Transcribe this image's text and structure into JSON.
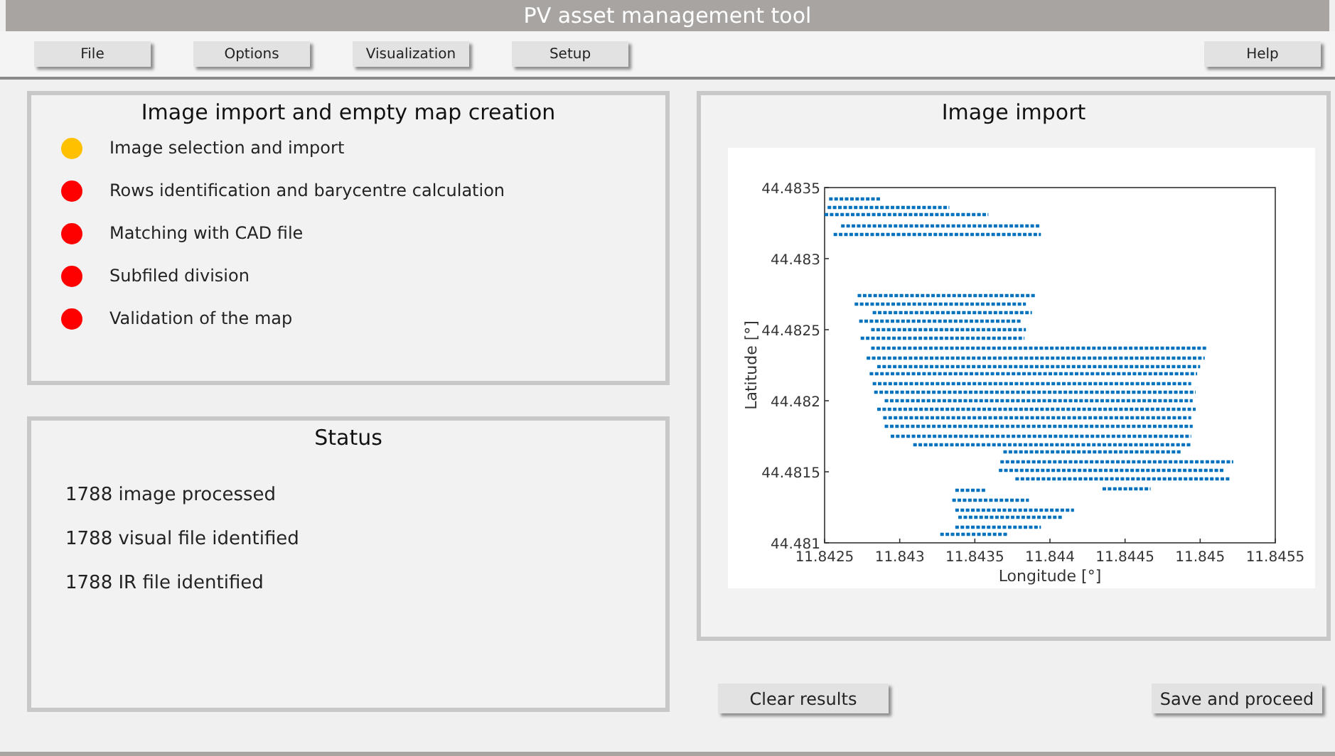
{
  "window": {
    "title": "PV asset management tool"
  },
  "menu": {
    "left": [
      "File",
      "Options",
      "Visualization",
      "Setup"
    ],
    "right": [
      "Help"
    ]
  },
  "steps_panel": {
    "title": "Image import and empty map creation",
    "steps": [
      {
        "label": "Image selection and import",
        "color": "#ffc000"
      },
      {
        "label": "Rows identification and barycentre calculation",
        "color": "#ff0000"
      },
      {
        "label": "Matching with CAD file",
        "color": "#ff0000"
      },
      {
        "label": "Subfiled division",
        "color": "#ff0000"
      },
      {
        "label": "Validation of the map",
        "color": "#ff0000"
      }
    ]
  },
  "status_panel": {
    "title": "Status",
    "lines": [
      "1788 image processed",
      "1788 visual file identified",
      "1788 IR file identified"
    ]
  },
  "image_panel": {
    "title": "Image import",
    "chart_data": {
      "type": "line",
      "xlabel": "Longitude [°]",
      "ylabel": "Latitude [°]",
      "xlim": [
        11.8425,
        11.8455
      ],
      "ylim": [
        44.481,
        44.4835
      ],
      "xticks": [
        11.8425,
        11.843,
        11.8435,
        11.844,
        11.8445,
        11.845,
        11.8455
      ],
      "yticks": [
        44.481,
        44.4815,
        44.482,
        44.4825,
        44.483,
        44.4835
      ],
      "series": [
        {
          "color": "#0072bd",
          "line_style": "dotted",
          "x": [
            11.84253,
            11.84287
          ],
          "values": [
            44.48342,
            44.48342
          ]
        },
        {
          "color": "#0072bd",
          "line_style": "dotted",
          "x": [
            11.84252,
            11.84333
          ],
          "values": [
            44.48336,
            44.48336
          ]
        },
        {
          "color": "#0072bd",
          "line_style": "dotted",
          "x": [
            11.8425,
            11.84359
          ],
          "values": [
            44.48331,
            44.48331
          ]
        },
        {
          "color": "#0072bd",
          "line_style": "dotted",
          "x": [
            11.84261,
            11.84393
          ],
          "values": [
            44.48323,
            44.48323
          ]
        },
        {
          "color": "#0072bd",
          "line_style": "dotted",
          "x": [
            11.84256,
            11.84394
          ],
          "values": [
            44.48317,
            44.48317
          ]
        },
        {
          "color": "#0072bd",
          "line_style": "dotted",
          "x": [
            11.84272,
            11.8439
          ],
          "values": [
            44.48274,
            44.48274
          ]
        },
        {
          "color": "#0072bd",
          "line_style": "dotted",
          "x": [
            11.8427,
            11.84384
          ],
          "values": [
            44.48268,
            44.48268
          ]
        },
        {
          "color": "#0072bd",
          "line_style": "dotted",
          "x": [
            11.84282,
            11.84388
          ],
          "values": [
            44.48262,
            44.48262
          ]
        },
        {
          "color": "#0072bd",
          "line_style": "dotted",
          "x": [
            11.84273,
            11.84381
          ],
          "values": [
            44.48256,
            44.48256
          ]
        },
        {
          "color": "#0072bd",
          "line_style": "dotted",
          "x": [
            11.84281,
            11.84384
          ],
          "values": [
            44.4825,
            44.4825
          ]
        },
        {
          "color": "#0072bd",
          "line_style": "dotted",
          "x": [
            11.84274,
            11.84383
          ],
          "values": [
            44.48244,
            44.48244
          ]
        },
        {
          "color": "#0072bd",
          "line_style": "dotted",
          "x": [
            11.84281,
            11.84504
          ],
          "values": [
            44.48237,
            44.48237
          ]
        },
        {
          "color": "#0072bd",
          "line_style": "dotted",
          "x": [
            11.84278,
            11.84503
          ],
          "values": [
            44.4823,
            44.4823
          ]
        },
        {
          "color": "#0072bd",
          "line_style": "dotted",
          "x": [
            11.84285,
            11.845
          ],
          "values": [
            44.48224,
            44.48224
          ]
        },
        {
          "color": "#0072bd",
          "line_style": "dotted",
          "x": [
            11.8428,
            11.84498
          ],
          "values": [
            44.48219,
            44.48219
          ]
        },
        {
          "color": "#0072bd",
          "line_style": "dotted",
          "x": [
            11.84282,
            11.84494
          ],
          "values": [
            44.48212,
            44.48212
          ]
        },
        {
          "color": "#0072bd",
          "line_style": "dotted",
          "x": [
            11.84283,
            11.84497
          ],
          "values": [
            44.48206,
            44.48206
          ]
        },
        {
          "color": "#0072bd",
          "line_style": "dotted",
          "x": [
            11.8429,
            11.84495
          ],
          "values": [
            44.482,
            44.482
          ]
        },
        {
          "color": "#0072bd",
          "line_style": "dotted",
          "x": [
            11.84285,
            11.84497
          ],
          "values": [
            44.48194,
            44.48194
          ]
        },
        {
          "color": "#0072bd",
          "line_style": "dotted",
          "x": [
            11.84289,
            11.84494
          ],
          "values": [
            44.48188,
            44.48188
          ]
        },
        {
          "color": "#0072bd",
          "line_style": "dotted",
          "x": [
            11.8429,
            11.84495
          ],
          "values": [
            44.48182,
            44.48182
          ]
        },
        {
          "color": "#0072bd",
          "line_style": "dotted",
          "x": [
            11.84294,
            11.84494
          ],
          "values": [
            44.48175,
            44.48175
          ]
        },
        {
          "color": "#0072bd",
          "line_style": "dotted",
          "x": [
            11.84309,
            11.84494
          ],
          "values": [
            44.48169,
            44.48169
          ]
        },
        {
          "color": "#0072bd",
          "line_style": "dotted",
          "x": [
            11.84369,
            11.84487
          ],
          "values": [
            44.48164,
            44.48164
          ]
        },
        {
          "color": "#0072bd",
          "line_style": "dotted",
          "x": [
            11.84367,
            11.84522
          ],
          "values": [
            44.48157,
            44.48157
          ]
        },
        {
          "color": "#0072bd",
          "line_style": "dotted",
          "x": [
            11.84366,
            11.84516
          ],
          "values": [
            44.48151,
            44.48151
          ]
        },
        {
          "color": "#0072bd",
          "line_style": "dotted",
          "x": [
            11.84377,
            11.8452
          ],
          "values": [
            44.48145,
            44.48145
          ]
        },
        {
          "color": "#0072bd",
          "line_style": "dotted",
          "x": [
            11.84435,
            11.84467
          ],
          "values": [
            44.48138,
            44.48138
          ]
        },
        {
          "color": "#0072bd",
          "line_style": "dotted",
          "x": [
            11.84337,
            11.84358
          ],
          "values": [
            44.48137,
            44.48137
          ]
        },
        {
          "color": "#0072bd",
          "line_style": "dotted",
          "x": [
            11.84335,
            11.84386
          ],
          "values": [
            44.4813,
            44.4813
          ]
        },
        {
          "color": "#0072bd",
          "line_style": "dotted",
          "x": [
            11.84337,
            11.84416
          ],
          "values": [
            44.48123,
            44.48123
          ]
        },
        {
          "color": "#0072bd",
          "line_style": "dotted",
          "x": [
            11.84339,
            11.84409
          ],
          "values": [
            44.48118,
            44.48118
          ]
        },
        {
          "color": "#0072bd",
          "line_style": "dotted",
          "x": [
            11.84337,
            11.84394
          ],
          "values": [
            44.48111,
            44.48111
          ]
        },
        {
          "color": "#0072bd",
          "line_style": "dotted",
          "x": [
            11.84327,
            11.84372
          ],
          "values": [
            44.48106,
            44.48106
          ]
        }
      ]
    }
  },
  "actions": [
    "Clear results",
    "Save and proceed"
  ]
}
